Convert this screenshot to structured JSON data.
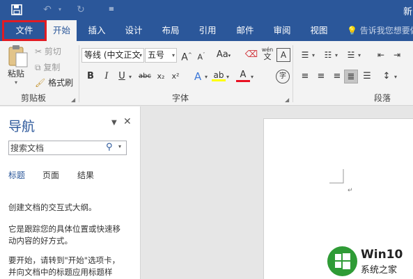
{
  "titlebar": {
    "save_icon": "save-icon",
    "undo_icon": "undo-icon",
    "redo_icon": "redo-icon",
    "customize_icon": "customize-quick-access-icon",
    "doc_title": "新"
  },
  "tabs": [
    {
      "label": "文件"
    },
    {
      "label": "开始"
    },
    {
      "label": "插入"
    },
    {
      "label": "设计"
    },
    {
      "label": "布局"
    },
    {
      "label": "引用"
    },
    {
      "label": "邮件"
    },
    {
      "label": "审阅"
    },
    {
      "label": "视图"
    }
  ],
  "tell_me": "告诉我您想要做",
  "ribbon": {
    "clipboard": {
      "label": "剪贴板",
      "paste": "粘贴",
      "cut": "剪切",
      "copy": "复制",
      "format_painter": "格式刷"
    },
    "font": {
      "label": "字体",
      "font_name": "等线 (中文正文",
      "font_size": "五号",
      "grow": "A",
      "shrink": "A",
      "change_case": "Aa",
      "phonetic": "wén",
      "border_char": "A",
      "bold": "B",
      "italic": "I",
      "underline": "U",
      "strikethrough": "abc",
      "subscript": "x₂",
      "superscript": "x²",
      "text_effects": "A",
      "font_color": "A",
      "enclose": "字",
      "highlight_color": "#ffff00",
      "font_color_value": "#e81123"
    },
    "paragraph": {
      "label": "段落"
    }
  },
  "nav": {
    "title": "导航",
    "search_placeholder": "搜索文档",
    "tabs": [
      "标题",
      "页面",
      "结果"
    ],
    "message1": "创建文档的交互式大纲。",
    "message2a": "它是跟踪您的具体位置或快速移",
    "message2b": "动内容的好方式。",
    "message3a": "要开始，请转到\"开始\"选项卡，",
    "message3b": "并向文档中的标题应用标题样"
  },
  "watermark": {
    "line1": "Win10",
    "line2": "系统之家"
  },
  "colors": {
    "brand": "#2b579a",
    "file_highlight": "#e21b23",
    "logo_green": "#2f9b36"
  }
}
